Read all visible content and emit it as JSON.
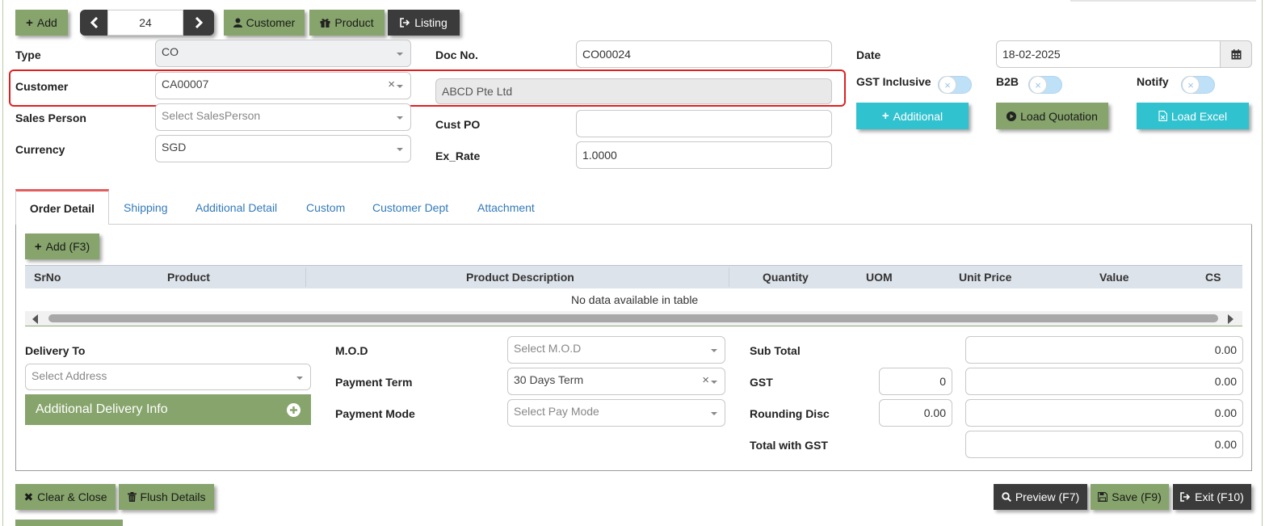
{
  "toolbar": {
    "add_label": "Add",
    "page_number": "24",
    "customer_label": "Customer",
    "product_label": "Product",
    "listing_label": "Listing"
  },
  "form": {
    "type_label": "Type",
    "type_value": "CO",
    "doc_no_label": "Doc No.",
    "doc_no_value": "CO00024",
    "date_label": "Date",
    "date_value": "18-02-2025",
    "customer_label": "Customer",
    "customer_code": "CA00007",
    "customer_name": "ABCD Pte Ltd",
    "gst_inclusive_label": "GST Inclusive",
    "b2b_label": "B2B",
    "notify_label": "Notify",
    "sales_person_label": "Sales Person",
    "sales_person_placeholder": "Select SalesPerson",
    "cust_po_label": "Cust PO",
    "cust_po_value": "",
    "currency_label": "Currency",
    "currency_value": "SGD",
    "ex_rate_label": "Ex_Rate",
    "ex_rate_value": "1.0000",
    "additional_button": "Additional",
    "load_quotation_button": "Load Quotation",
    "load_excel_button": "Load Excel"
  },
  "tabs": [
    {
      "label": "Order Detail",
      "active": true
    },
    {
      "label": "Shipping"
    },
    {
      "label": "Additional Detail"
    },
    {
      "label": "Custom"
    },
    {
      "label": "Customer Dept"
    },
    {
      "label": "Attachment"
    }
  ],
  "table": {
    "add_button": "Add (F3)",
    "columns": [
      "SrNo",
      "Product",
      "Product Description",
      "Quantity",
      "UOM",
      "Unit Price",
      "Value",
      "CS"
    ],
    "empty_message": "No data available in table"
  },
  "footer_form": {
    "delivery_to_label": "Delivery To",
    "address_placeholder": "Select Address",
    "additional_delivery_info": "Additional Delivery Info",
    "mod_label": "M.O.D",
    "mod_placeholder": "Select M.O.D",
    "payment_term_label": "Payment Term",
    "payment_term_value": "30 Days Term",
    "payment_mode_label": "Payment Mode",
    "payment_mode_placeholder": "Select Pay Mode",
    "sub_total_label": "Sub Total",
    "sub_total_value": "0.00",
    "gst_label": "GST",
    "gst_rate": "0",
    "gst_value": "0.00",
    "rounding_label": "Rounding Disc",
    "rounding_input": "0.00",
    "rounding_value": "0.00",
    "total_label": "Total with GST",
    "total_value": "0.00"
  },
  "actions": {
    "clear_close": "Clear & Close",
    "flush_details": "Flush Details",
    "preview": "Preview (F7)",
    "save": "Save (F9)",
    "exit": "Exit (F10)"
  },
  "colors": {
    "green_button": "#86a46b",
    "dark_button": "#3b3b3b",
    "teal_button": "#31c2cf",
    "active_tab_border": "#e25d5d",
    "highlight": "#e02020"
  }
}
